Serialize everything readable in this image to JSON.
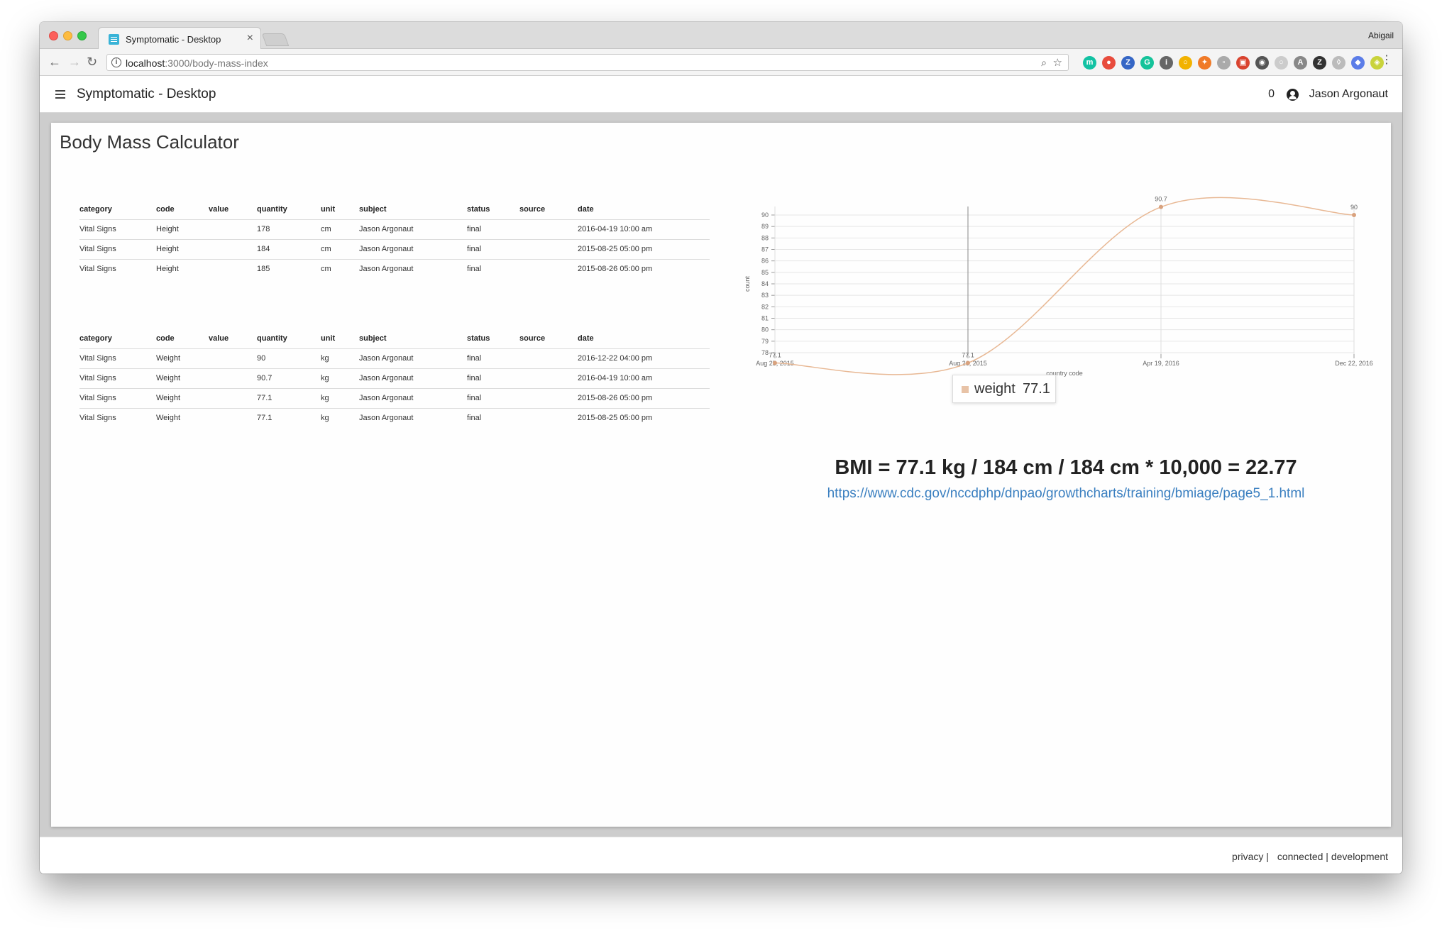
{
  "browser": {
    "tab_title": "Symptomatic - Desktop",
    "profile_name": "Abigail",
    "url_host": "localhost",
    "url_path": ":3000/body-mass-index"
  },
  "extensions": [
    {
      "name": "extension-m-icon",
      "color": "#12c2a3",
      "glyph": "m"
    },
    {
      "name": "extension-red-icon",
      "color": "#e84c3d",
      "glyph": "●"
    },
    {
      "name": "extension-z-icon",
      "color": "#3566c5",
      "glyph": "Z"
    },
    {
      "name": "extension-grammarly-icon",
      "color": "#15c39a",
      "glyph": "G"
    },
    {
      "name": "extension-info-icon",
      "color": "#666666",
      "glyph": "i"
    },
    {
      "name": "extension-yellow-icon",
      "color": "#f2b200",
      "glyph": "○"
    },
    {
      "name": "extension-orange-icon",
      "color": "#f07a27",
      "glyph": "✦"
    },
    {
      "name": "extension-gray-icon",
      "color": "#aaaaaa",
      "glyph": "▫"
    },
    {
      "name": "extension-image-icon",
      "color": "#d9432f",
      "glyph": "▣"
    },
    {
      "name": "extension-dark-icon",
      "color": "#555555",
      "glyph": "◉"
    },
    {
      "name": "extension-light-icon",
      "color": "#cccccc",
      "glyph": "○"
    },
    {
      "name": "extension-a-icon",
      "color": "#888888",
      "glyph": "A"
    },
    {
      "name": "extension-zotero-icon",
      "color": "#333333",
      "glyph": "Z"
    },
    {
      "name": "extension-shield-icon",
      "color": "#bbbbbb",
      "glyph": "◊"
    },
    {
      "name": "extension-blue-icon",
      "color": "#5b7de8",
      "glyph": "◆"
    },
    {
      "name": "extension-lime-icon",
      "color": "#c9d33b",
      "glyph": "◈"
    }
  ],
  "app": {
    "title": "Symptomatic - Desktop",
    "notification_count": "0",
    "user_name": "Jason Argonaut"
  },
  "page": {
    "title": "Body Mass Calculator"
  },
  "height_table": {
    "headers": [
      "category",
      "code",
      "value",
      "quantity",
      "unit",
      "subject",
      "status",
      "source",
      "date"
    ],
    "rows": [
      [
        "Vital Signs",
        "Height",
        "",
        "178",
        "cm",
        "Jason Argonaut",
        "final",
        "",
        "2016-04-19 10:00 am"
      ],
      [
        "Vital Signs",
        "Height",
        "",
        "184",
        "cm",
        "Jason Argonaut",
        "final",
        "",
        "2015-08-25 05:00 pm"
      ],
      [
        "Vital Signs",
        "Height",
        "",
        "185",
        "cm",
        "Jason Argonaut",
        "final",
        "",
        "2015-08-26 05:00 pm"
      ]
    ]
  },
  "weight_table": {
    "headers": [
      "category",
      "code",
      "value",
      "quantity",
      "unit",
      "subject",
      "status",
      "source",
      "date"
    ],
    "rows": [
      [
        "Vital Signs",
        "Weight",
        "",
        "90",
        "kg",
        "Jason Argonaut",
        "final",
        "",
        "2016-12-22 04:00 pm"
      ],
      [
        "Vital Signs",
        "Weight",
        "",
        "90.7",
        "kg",
        "Jason Argonaut",
        "final",
        "",
        "2016-04-19 10:00 am"
      ],
      [
        "Vital Signs",
        "Weight",
        "",
        "77.1",
        "kg",
        "Jason Argonaut",
        "final",
        "",
        "2015-08-26 05:00 pm"
      ],
      [
        "Vital Signs",
        "Weight",
        "",
        "77.1",
        "kg",
        "Jason Argonaut",
        "final",
        "",
        "2015-08-25 05:00 pm"
      ]
    ]
  },
  "chart_data": {
    "type": "line",
    "categories": [
      "Aug 25, 2015",
      "Aug 26, 2015",
      "Apr 19, 2016",
      "Dec 22, 2016"
    ],
    "series": [
      {
        "name": "weight",
        "values": [
          77.1,
          77.1,
          90.7,
          90
        ]
      }
    ],
    "data_labels": [
      "77.1",
      "77.1",
      "90.7",
      "90"
    ],
    "xlabel": "country code",
    "ylabel": "count",
    "ylim": [
      78,
      90
    ],
    "yticks": [
      78,
      79,
      80,
      81,
      82,
      83,
      84,
      85,
      86,
      87,
      88,
      89,
      90
    ],
    "grid": true,
    "line_color": "#e8b894",
    "tooltip": {
      "name": "weight",
      "value": "77.1"
    }
  },
  "bmi": {
    "formula": "BMI = 77.1 kg / 184 cm / 184 cm * 10,000 = 22.77",
    "link": "https://www.cdc.gov/nccdphp/dnpao/growthcharts/training/bmiage/page5_1.html"
  },
  "footer": {
    "privacy": "privacy |",
    "status": "connected | development"
  }
}
